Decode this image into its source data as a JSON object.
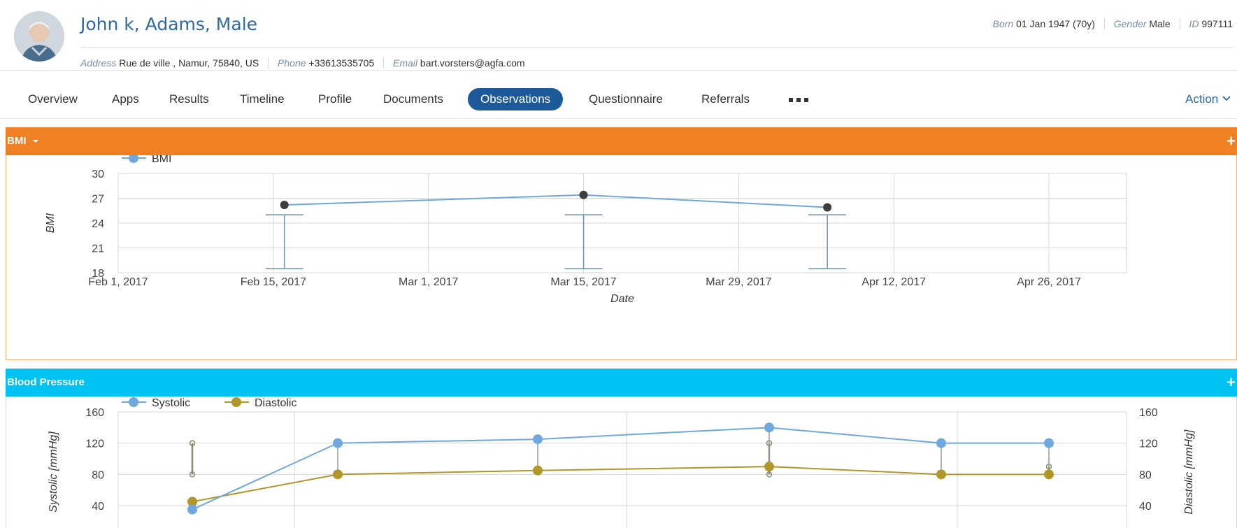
{
  "patient": {
    "name": "John k, Adams, Male",
    "born_label": "Born",
    "born_value": "01 Jan 1947 (70y)",
    "gender_label": "Gender",
    "gender_value": "Male",
    "id_label": "ID",
    "id_value": "997111",
    "address_label": "Address",
    "address_value": "Rue de ville , Namur, 75840, US",
    "phone_label": "Phone",
    "phone_value": "+33613535705",
    "email_label": "Email",
    "email_value": "bart.vorsters@agfa.com"
  },
  "nav": {
    "tabs": [
      "Overview",
      "Apps",
      "Results",
      "Timeline",
      "Profile",
      "Documents",
      "Observations",
      "Questionnaire",
      "Referrals"
    ],
    "active": "Observations",
    "more_icon": "ellipsis-icon",
    "action_label": "Action",
    "action_icon": "chevron-down-icon"
  },
  "panels": {
    "bmi_title": "BMI",
    "bmi_dropdown_icon": "caret-down-icon",
    "bp_title": "Blood Pressure",
    "add_icon": "plus-icon",
    "add_symbol": "+"
  },
  "colors": {
    "bmi_header": "#ef8023",
    "bp_header": "#00c3f3",
    "active_tab": "#1d5a99",
    "systolic": "#6fa8dc",
    "diastolic": "#b1962b",
    "bmi_line": "#6fa8dc"
  },
  "chart_data": [
    {
      "type": "line",
      "legend": [
        "BMI"
      ],
      "ylabel": "BMI",
      "xlabel": "Date",
      "ylim": [
        18,
        30
      ],
      "yticks": [
        18,
        21,
        24,
        27,
        30
      ],
      "xlim": [
        "2017-02-01",
        "2017-05-03"
      ],
      "xticks": [
        "Feb 1, 2017",
        "Feb 15, 2017",
        "Mar 1, 2017",
        "Mar 15, 2017",
        "Mar 29, 2017",
        "Apr 12, 2017",
        "Apr 26, 2017"
      ],
      "series": [
        {
          "name": "BMI",
          "x": [
            "2017-02-16",
            "2017-03-15",
            "2017-04-06"
          ],
          "y": [
            26.2,
            27.4,
            25.9
          ],
          "range_low": [
            18.5,
            18.5,
            18.5
          ],
          "range_high": [
            25,
            25,
            25
          ]
        }
      ]
    },
    {
      "type": "line",
      "legend": [
        "Systolic",
        "Diastolic"
      ],
      "ylabel_left": "Systolic [mmHg]",
      "ylabel_right": "Diastolic [mmHg]",
      "ylim": [
        0,
        160
      ],
      "yticks": [
        40,
        80,
        120,
        160
      ],
      "series": [
        {
          "name": "Systolic",
          "y": [
            35,
            120,
            125,
            140,
            120,
            120
          ]
        },
        {
          "name": "Diastolic",
          "y": [
            45,
            80,
            85,
            90,
            80,
            80
          ]
        }
      ],
      "reference_ranges": [
        {
          "low": 80,
          "high": 120
        },
        {
          "low": 80,
          "high": 120
        },
        {
          "low": 80,
          "high": 90
        }
      ]
    }
  ]
}
